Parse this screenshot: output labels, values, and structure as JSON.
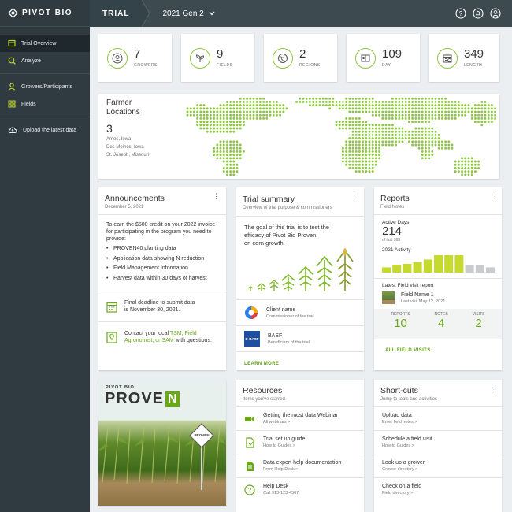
{
  "brand": {
    "name": "PIVOT BIO",
    "accent": "#8dc63f",
    "sidebar_bg": "#2f3b40"
  },
  "sidebar": {
    "items": [
      {
        "label": "Trial Overview",
        "icon": "overview-icon"
      },
      {
        "label": "Analyze",
        "icon": "analyze-icon"
      },
      {
        "label": "Growers/Participants",
        "icon": "person-icon"
      },
      {
        "label": "Fields",
        "icon": "grid-icon"
      },
      {
        "label": "Upload the latest data",
        "icon": "cloud-upload-icon"
      }
    ]
  },
  "topbar": {
    "section": "TRIAL",
    "trial_name": "2021 Gen 2"
  },
  "stats": [
    {
      "value": "7",
      "label": "GROWERS",
      "icon": "person-icon"
    },
    {
      "value": "9",
      "label": "FIELDS",
      "icon": "sprout-icon"
    },
    {
      "value": "2",
      "label": "REGIONS",
      "icon": "globe-icon"
    },
    {
      "value": "109",
      "label": "DAY",
      "icon": "calendar-day-icon"
    },
    {
      "value": "349",
      "label": "LENGTH",
      "icon": "calendar-length-icon"
    }
  ],
  "farmer_locations": {
    "title_line1": "Farmer",
    "title_line2": "Locations",
    "count": "3",
    "locations": [
      "Ames, Iowa",
      "Des Moines, Iowa",
      "St. Joseph, Missouri"
    ]
  },
  "announcements": {
    "title": "Announcements",
    "date": "December 5, 2021",
    "intro": "To earn the $500 credit on your 2022 invoice for participating in the program you need to provide:",
    "bullets": [
      "PROVEN40 planting data",
      "Application data showing N reduction",
      "Field Management Information",
      "Harvest data within 30 days of harvest"
    ],
    "deadline_line1": "Final deadline to submit data",
    "deadline_line2": "is November 30, 2021.",
    "contact_line1_pre": "Contact your local ",
    "contact_link1": "TSM, Field",
    "contact_link2": "Agronomist, or SAM",
    "contact_post": " with questions."
  },
  "trial_summary": {
    "title": "Trial summary",
    "subtitle": "Overview of trial purpose & commissioners",
    "goal_line1": "The goal of this trial is to test the",
    "goal_line2": "efficacy of Pivot Bio Proven",
    "goal_line3": "on corn growth.",
    "client_name": "Client name",
    "client_role": "Commissioner of the trail",
    "basf_name": "BASF",
    "basf_role": "Beneficiary of the trial",
    "basf_logo_text": "D-BASF",
    "learn_more": "LEARN MORE"
  },
  "reports": {
    "title": "Reports",
    "subtitle": "Field Notes",
    "active_days_label": "Active Days",
    "active_days": "214",
    "active_days_of": "of last 365",
    "activity_label": "2021 Activity",
    "activity_values": [
      0.3,
      0.45,
      0.5,
      0.6,
      0.75,
      1.0,
      1.0,
      1.0,
      0.45,
      0.45,
      0.3
    ],
    "activity_active_count": 8,
    "latest_label": "Latest Field visit report",
    "field_name": "Field Name 1",
    "last_visit": "Last visit May 12, 2021",
    "counts": [
      {
        "label": "REPORTS",
        "value": "10"
      },
      {
        "label": "NOTES",
        "value": "4"
      },
      {
        "label": "VISITS",
        "value": "2"
      }
    ],
    "all_visits": "ALL FIELD VISITS"
  },
  "promo": {
    "brand": "PIVOT BIO",
    "word": "PROVE",
    "word_n": "N",
    "sign": "PROVEN"
  },
  "resources": {
    "title": "Resources",
    "subtitle": "Items you've starred",
    "items": [
      {
        "title": "Getting the most data Webinar",
        "sub": "All webinars >",
        "icon": "video-icon"
      },
      {
        "title": "Trial set up guide",
        "sub": "How to Guides >",
        "icon": "document-icon"
      },
      {
        "title": "Data export help documentation",
        "sub": "From Help Desk >",
        "icon": "document-lines-icon"
      },
      {
        "title": "Help Desk",
        "sub": "Call 913-123-4567",
        "icon": "question-icon"
      }
    ]
  },
  "shortcuts": {
    "title": "Short-cuts",
    "subtitle": "Jump to tools and activities",
    "items": [
      {
        "title": "Upload data",
        "sub": "Enter field notes >"
      },
      {
        "title": "Schedule a field visit",
        "sub": "How to Guides >"
      },
      {
        "title": "Look up a grower",
        "sub": "Grower directory >"
      },
      {
        "title": "Check on a field",
        "sub": "Field directory >"
      }
    ]
  }
}
